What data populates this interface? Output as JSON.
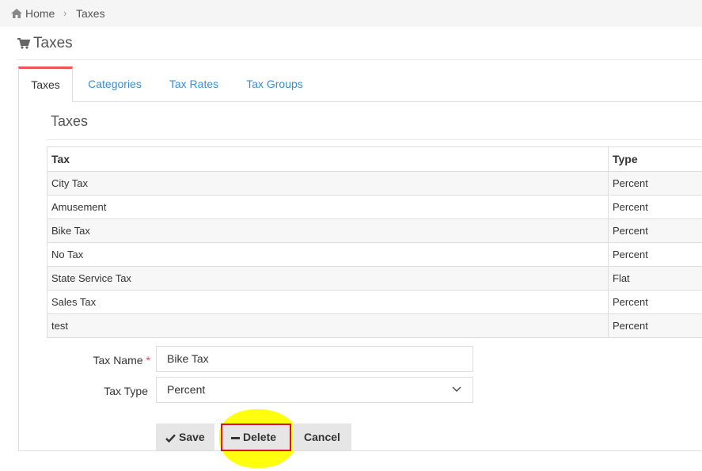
{
  "breadcrumb": {
    "home": "Home",
    "separator": "›",
    "current": "Taxes"
  },
  "page": {
    "title": "Taxes"
  },
  "tabs": [
    {
      "label": "Taxes",
      "active": true
    },
    {
      "label": "Categories",
      "active": false
    },
    {
      "label": "Tax Rates",
      "active": false
    },
    {
      "label": "Tax Groups",
      "active": false
    }
  ],
  "section": {
    "title": "Taxes"
  },
  "table": {
    "columns": [
      "Tax",
      "Type"
    ],
    "rows": [
      [
        "City Tax",
        "Percent"
      ],
      [
        "Amusement",
        "Percent"
      ],
      [
        "Bike Tax",
        "Percent"
      ],
      [
        "No Tax",
        "Percent"
      ],
      [
        "State Service Tax",
        "Flat"
      ],
      [
        "Sales Tax",
        "Percent"
      ],
      [
        "test",
        "Percent"
      ]
    ]
  },
  "form": {
    "tax_name_label": "Tax Name",
    "required_mark": "*",
    "tax_name_value": "Bike Tax",
    "tax_type_label": "Tax Type",
    "tax_type_value": "Percent"
  },
  "buttons": {
    "save": "Save",
    "delete": "Delete",
    "cancel": "Cancel"
  },
  "colors": {
    "accent": "#3a8ecf",
    "active_tab_border": "#e55555",
    "highlight": "#ffff00",
    "annotation_box": "#d8122a"
  }
}
